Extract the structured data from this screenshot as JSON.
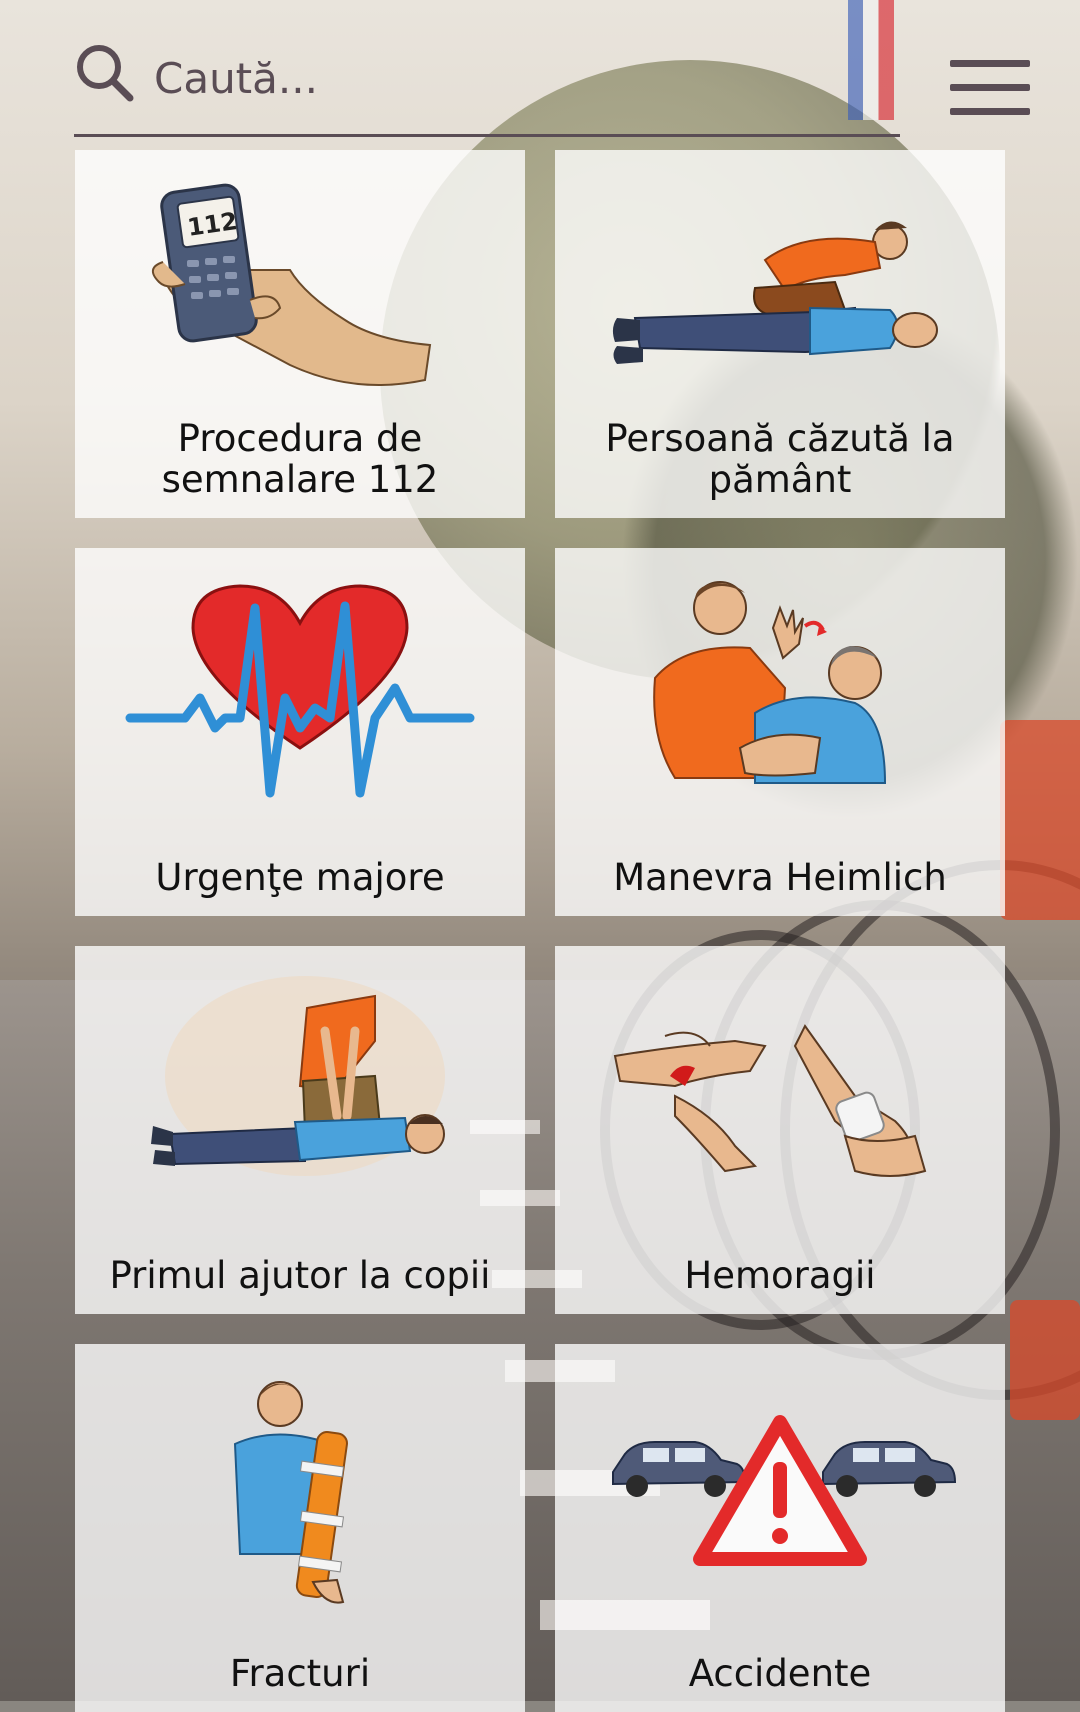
{
  "search": {
    "placeholder": "Caută...",
    "icon": "search-icon"
  },
  "header": {
    "menu_icon": "hamburger-menu-icon"
  },
  "categories": [
    {
      "label": "Procedura de semnalare 112",
      "icon": "phone-112-icon"
    },
    {
      "label": "Persoană căzută la pământ",
      "icon": "person-on-ground-icon"
    },
    {
      "label": "Urgenţe majore",
      "icon": "heart-pulse-icon"
    },
    {
      "label": "Manevra Heimlich",
      "icon": "heimlich-icon"
    },
    {
      "label": "Primul ajutor la copii",
      "icon": "child-cpr-icon"
    },
    {
      "label": "Hemoragii",
      "icon": "bandage-icon"
    },
    {
      "label": "Fracturi",
      "icon": "splint-arm-icon"
    },
    {
      "label": "Accidente",
      "icon": "car-accident-warning-icon"
    }
  ],
  "colors": {
    "text": "#111111",
    "search_accent": "#5a4d55",
    "card_background": "#ffffff",
    "warning_red": "#e32a2a",
    "shirt_blue": "#4aa2dc",
    "shirt_orange": "#f06a1e"
  }
}
